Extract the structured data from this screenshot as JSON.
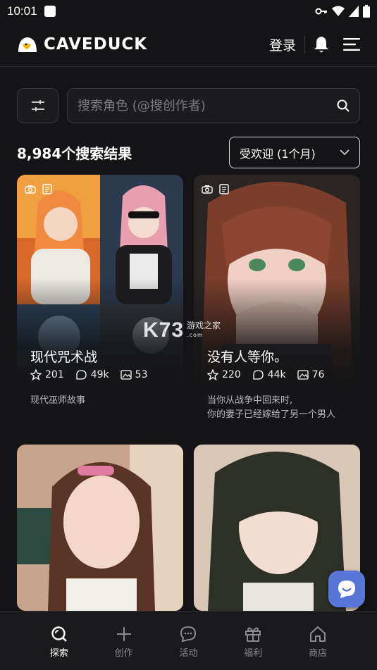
{
  "status_bar": {
    "time": "10:01"
  },
  "header": {
    "logo_text": "CAVEDUCK",
    "login_label": "登录"
  },
  "search": {
    "placeholder": "搜索角色 (@搜创作者)"
  },
  "results": {
    "count_text": "8,984个搜索结果",
    "sort_value": "受欢迎 (1个月)"
  },
  "cards": [
    {
      "title": "现代咒术战",
      "likes": "201",
      "chats": "49k",
      "images": "53",
      "description": "现代巫师故事"
    },
    {
      "title": "没有人等你。",
      "likes": "220",
      "chats": "44k",
      "images": "76",
      "description": "当你从战争中回来时,\n你的妻子已经嫁给了另一个男人"
    },
    {
      "title": "",
      "likes": "",
      "chats": "",
      "images": "",
      "description": ""
    },
    {
      "title": "",
      "likes": "",
      "chats": "",
      "images": "",
      "description": ""
    }
  ],
  "watermark": {
    "brand": "K73",
    "cn": "游戏之家",
    "en": ".com"
  },
  "bottom_nav": [
    {
      "label": "探索",
      "icon": "explore-icon",
      "active": true
    },
    {
      "label": "创作",
      "icon": "plus-icon",
      "active": false
    },
    {
      "label": "活动",
      "icon": "chat-bubble-icon",
      "active": false
    },
    {
      "label": "福利",
      "icon": "gift-icon",
      "active": false
    },
    {
      "label": "商店",
      "icon": "store-icon",
      "active": false
    }
  ],
  "colors": {
    "background": "#141416",
    "fab": "#5876d8",
    "accent_text": "#ffffff"
  }
}
